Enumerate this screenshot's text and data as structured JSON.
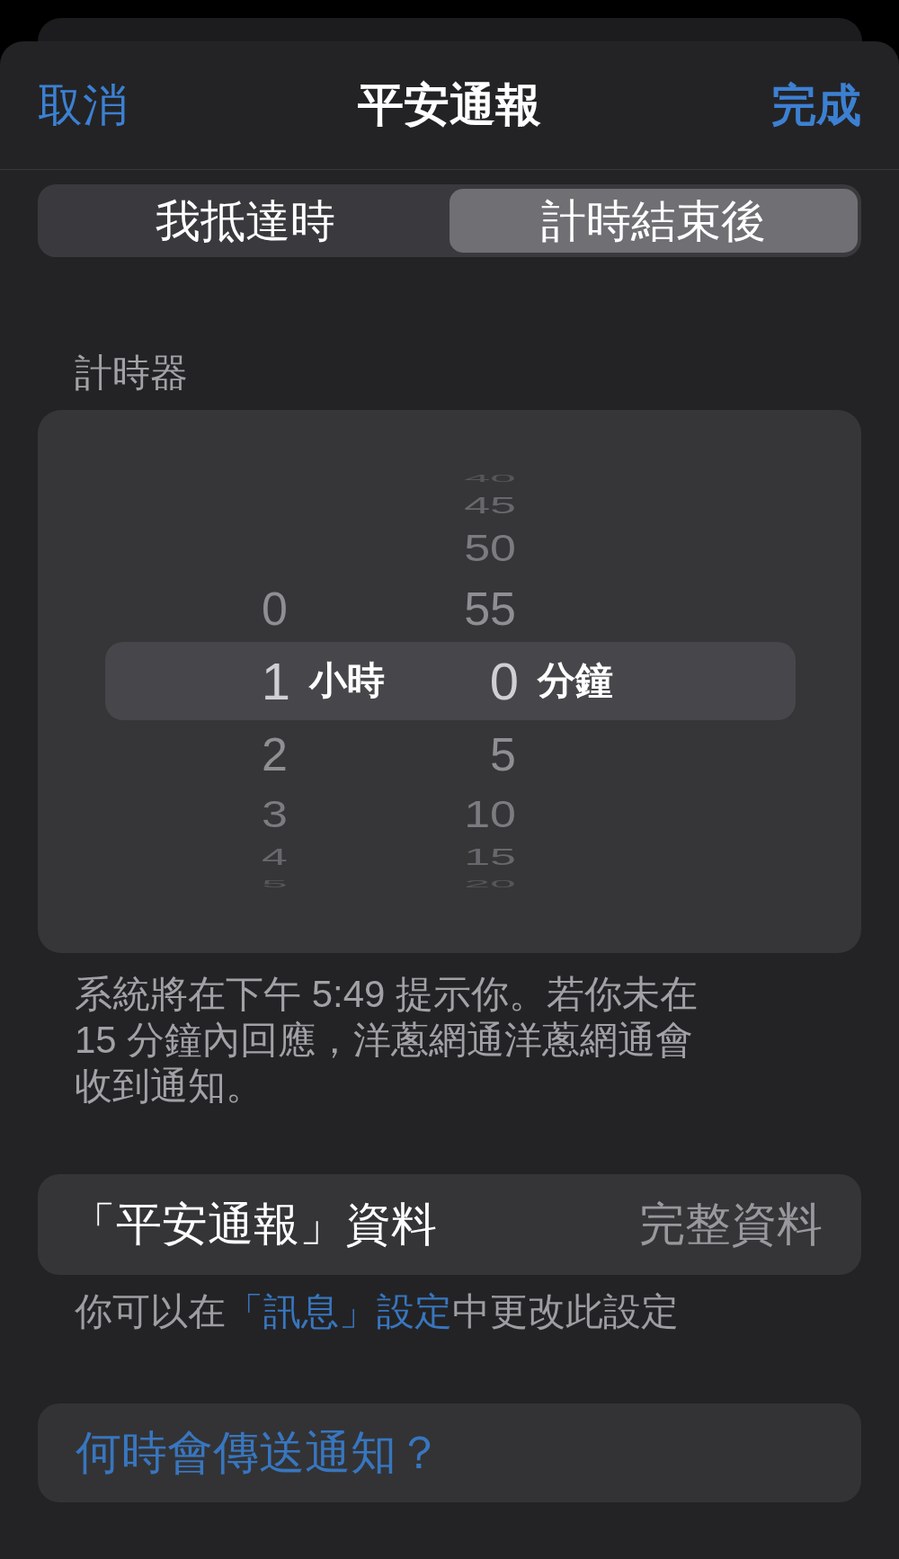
{
  "header": {
    "cancel": "取消",
    "title": "平安通報",
    "done": "完成"
  },
  "segments": [
    {
      "label": "我抵達時",
      "selected": false
    },
    {
      "label": "計時結束後",
      "selected": true
    }
  ],
  "timer": {
    "label": "計時器",
    "columns": [
      {
        "unit": "小時",
        "items": [
          {
            "label": "0",
            "selected": false
          },
          {
            "label": "1",
            "selected": true
          },
          {
            "label": "2",
            "selected": false
          },
          {
            "label": "3",
            "selected": false
          },
          {
            "label": "4",
            "selected": false
          },
          {
            "label": "5",
            "selected": false
          }
        ]
      },
      {
        "unit": "分鐘",
        "items": [
          {
            "label": "40",
            "selected": false
          },
          {
            "label": "45",
            "selected": false
          },
          {
            "label": "50",
            "selected": false
          },
          {
            "label": "55",
            "selected": false
          },
          {
            "label": "0",
            "selected": true
          },
          {
            "label": "5",
            "selected": false
          },
          {
            "label": "10",
            "selected": false
          },
          {
            "label": "15",
            "selected": false
          },
          {
            "label": "20",
            "selected": false
          }
        ]
      }
    ]
  },
  "description": "系統將在下午 5:49 提示你。若你未在 15 分鐘內回應，洋蔥網通洋蔥網通會收到通知。",
  "info_row": {
    "label": "「平安通報」資料",
    "value": "完整資料"
  },
  "footer_note": {
    "before": "你可以在",
    "link": "「訊息」設定",
    "after": "中更改此設定"
  },
  "help_button": "何時會傳送通知？"
}
